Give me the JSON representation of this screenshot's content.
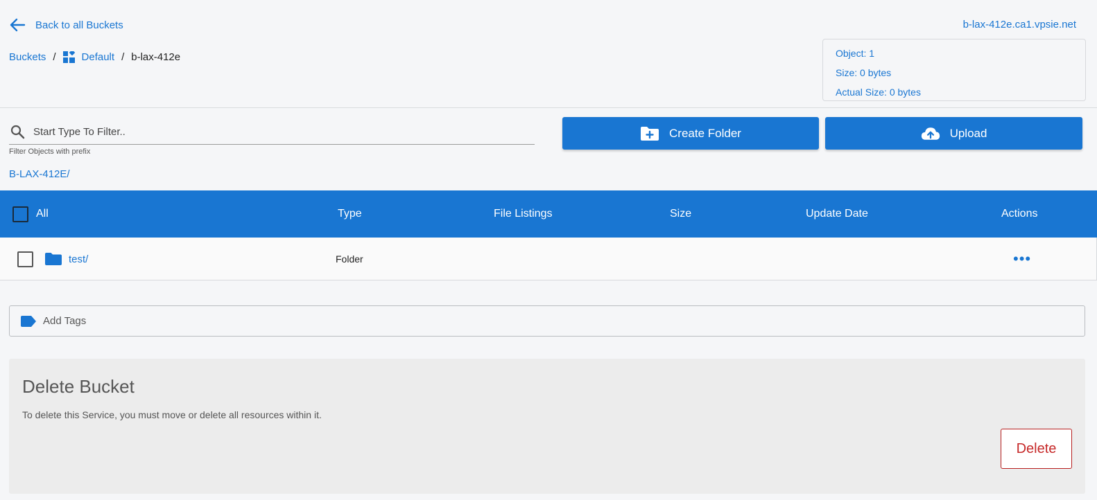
{
  "header": {
    "back_label": "Back to all Buckets",
    "host": "b-lax-412e.ca1.vpsie.net"
  },
  "breadcrumb": {
    "items": [
      "Buckets",
      "Default",
      "b-lax-412e"
    ],
    "separator": "/"
  },
  "stats": {
    "object": "Object: 1",
    "size": "Size: 0 bytes",
    "actual_size": "Actual Size: 0 bytes"
  },
  "filter": {
    "placeholder": "Start Type To Filter..",
    "value": "",
    "helper": "Filter Objects with prefix"
  },
  "actions": {
    "create_folder": "Create Folder",
    "upload": "Upload"
  },
  "path": "B-LAX-412E/",
  "table": {
    "columns": [
      "All",
      "Type",
      "File Listings",
      "Size",
      "Update Date",
      "Actions"
    ],
    "rows": [
      {
        "name": "test/",
        "type": "Folder",
        "file_listings": "",
        "size": "",
        "update_date": "",
        "actions": "•••"
      }
    ]
  },
  "tags": {
    "label": "Add Tags"
  },
  "delete_section": {
    "title": "Delete Bucket",
    "description": "To delete this Service, you must move or delete all resources within it.",
    "button": "Delete"
  },
  "colors": {
    "primary": "#1976d2",
    "danger": "#c62828",
    "background": "#f5f6f8"
  },
  "icons": {
    "back": "arrow-left-icon",
    "breadcrumb_group": "grid-icon",
    "search": "search-icon",
    "create_folder": "folder-plus-icon",
    "upload": "cloud-upload-icon",
    "folder": "folder-icon",
    "tag": "tag-icon",
    "more": "ellipsis-icon"
  }
}
